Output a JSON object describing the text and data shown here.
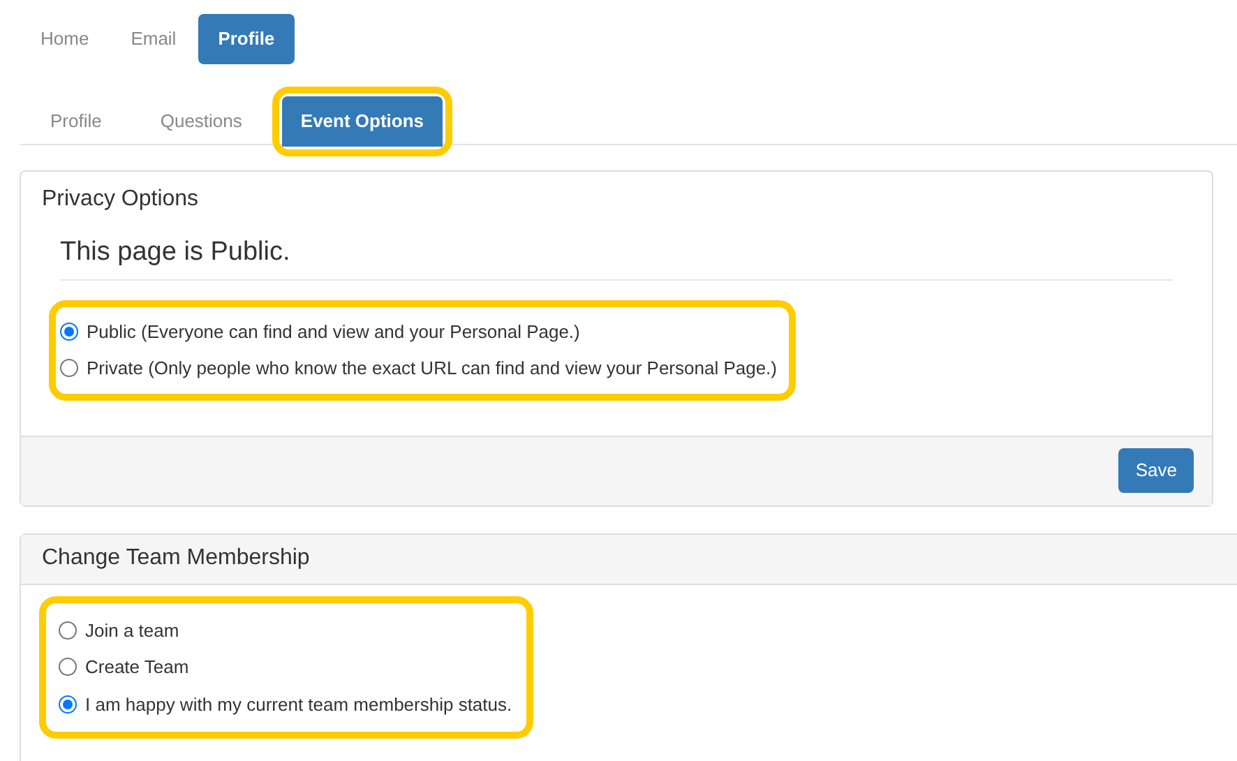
{
  "nav": [
    {
      "label": "Home",
      "selected": false
    },
    {
      "label": "Email",
      "selected": false
    },
    {
      "label": "Profile",
      "selected": true
    }
  ],
  "tabs": [
    {
      "label": "Profile",
      "selected": false,
      "highlighted": false
    },
    {
      "label": "Questions",
      "selected": false,
      "highlighted": false
    },
    {
      "label": "Event Options",
      "selected": true,
      "highlighted": true
    }
  ],
  "privacy": {
    "title": "Privacy Options",
    "heading": "This page is Public.",
    "highlighted": true,
    "options": [
      {
        "label": "Public (Everyone can find and view and your Personal Page.)",
        "selected": true
      },
      {
        "label": "Private (Only people who know the exact URL can find and view your Personal Page.)",
        "selected": false
      }
    ],
    "button": "Save"
  },
  "team": {
    "title": "Change Team Membership",
    "highlighted": true,
    "options": [
      {
        "label": "Join a team",
        "selected": false
      },
      {
        "label": "Create Team",
        "selected": false
      },
      {
        "label": "I am happy with my current team membership status.",
        "selected": true
      }
    ]
  }
}
